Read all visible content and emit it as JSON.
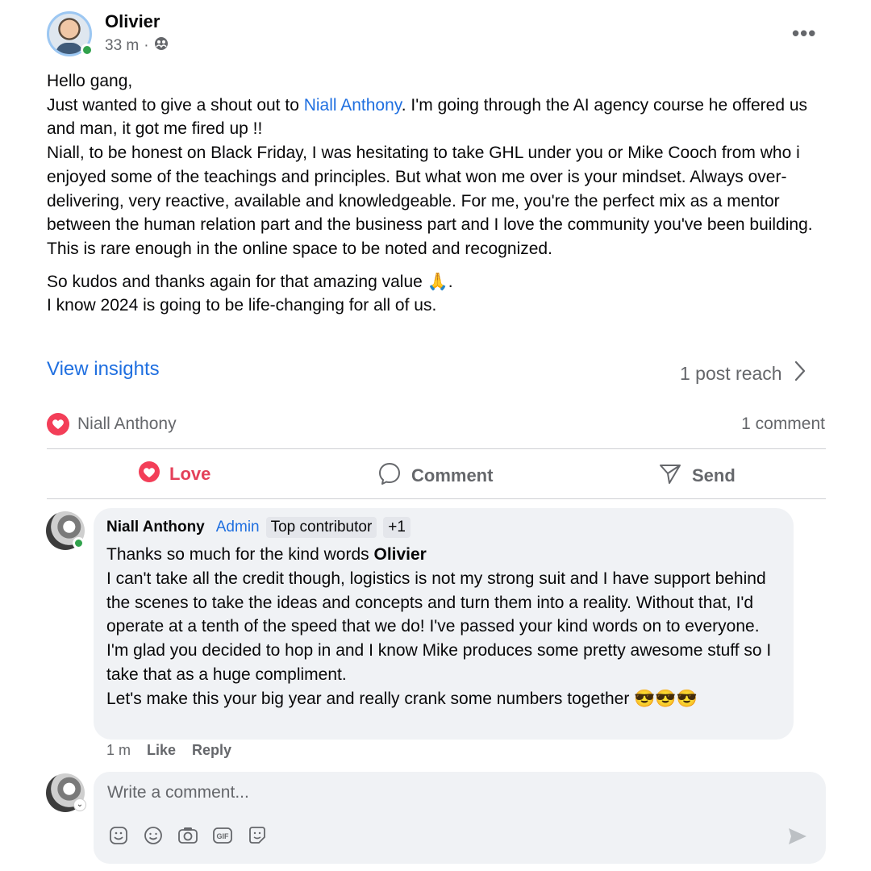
{
  "post": {
    "author": "Olivier",
    "time": "33 m",
    "separator": "·",
    "paragraphs": {
      "p1": "Hello gang,",
      "p2_before": "Just wanted to give a shout out to ",
      "p2_mention": "Niall Anthony",
      "p2_after": ". I'm going through the AI agency course he offered us and man, it got me fired up !!",
      "p3": "Niall, to be honest on Black Friday, I was hesitating to take GHL under you or Mike Cooch from who i enjoyed some of the teachings and principles. But what won me over is your mindset. Always over-delivering, very reactive, available and knowledgeable. For me, you're the perfect mix as a mentor between the human relation part and the business part and I love the community you've been building.",
      "p4": "This is rare enough in the online space to be noted and recognized.",
      "p5": "So kudos and thanks again for that amazing value 🙏.",
      "p6": "I know 2024 is going to be life-changing for all of us."
    }
  },
  "insights": {
    "label": "View insights",
    "reach": "1 post reach"
  },
  "reactions": {
    "by": "Niall Anthony",
    "comments_count": "1 comment"
  },
  "actions": {
    "love": "Love",
    "comment": "Comment",
    "send": "Send"
  },
  "comment": {
    "name": "Niall Anthony",
    "role": "Admin",
    "badge": "Top contributor",
    "extra": "+1",
    "line1_before": "Thanks so much for the kind words ",
    "line1_bold": "Olivier",
    "para1": "I can't take all the credit though, logistics is not my strong suit and I have support behind the scenes to take the ideas and concepts and turn them into a reality. Without that, I'd operate at a tenth of the speed that we do! I've passed your kind words on to everyone.",
    "para2": "I'm glad you decided to hop in and I know Mike produces some pretty awesome stuff so I take that as a huge compliment.",
    "para3": "Let's make this your big year and really crank some numbers together 😎😎😎",
    "time": "1 m",
    "like": "Like",
    "reply": "Reply"
  },
  "composer": {
    "placeholder": "Write a comment..."
  },
  "colors": {
    "accent_blue": "#1f6fe0",
    "love_red": "#e4415a",
    "online_green": "#31a24c"
  },
  "icons": [
    "more-options-icon",
    "friends-audience-icon",
    "chevron-right-icon",
    "heart-reaction-icon",
    "comment-icon",
    "send-icon",
    "sticker-icon",
    "emoji-icon",
    "camera-icon",
    "gif-icon",
    "avatar-sticker-icon",
    "submit-arrow-icon"
  ]
}
